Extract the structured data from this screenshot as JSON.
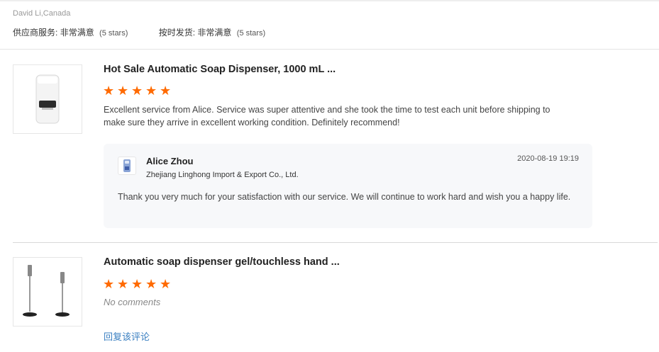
{
  "reviewer": {
    "name_location": "David Li,Canada"
  },
  "ratings": [
    {
      "label": "供应商服务:",
      "value": "非常满意",
      "note": "(5 stars)"
    },
    {
      "label": "按时发货:",
      "value": "非常满意",
      "note": "(5 stars)"
    }
  ],
  "reviews": [
    {
      "product_title": "Hot Sale Automatic Soap Dispenser, 1000 mL ...",
      "rating": 5,
      "text": "Excellent service from Alice. Service was super attentive and she took the time to test each unit before shipping to make sure they arrive in excellent working condition. Definitely recommend!",
      "reply": {
        "name": "Alice Zhou",
        "company": "Zhejiang Linghong Import & Export Co., Ltd.",
        "date": "2020-08-19 19:19",
        "text": "Thank you very much for your satisfaction with our service. We will continue to work hard and wish you a happy life."
      }
    },
    {
      "product_title": "Automatic soap dispenser gel/touchless hand ...",
      "rating": 5,
      "no_comments": "No comments",
      "reply_link": "回复该评论"
    }
  ],
  "colors": {
    "star": "#ff6a00",
    "link": "#3a7fc1",
    "reply_bg": "#f7f8fa"
  },
  "icons": {
    "star": "star-icon"
  }
}
